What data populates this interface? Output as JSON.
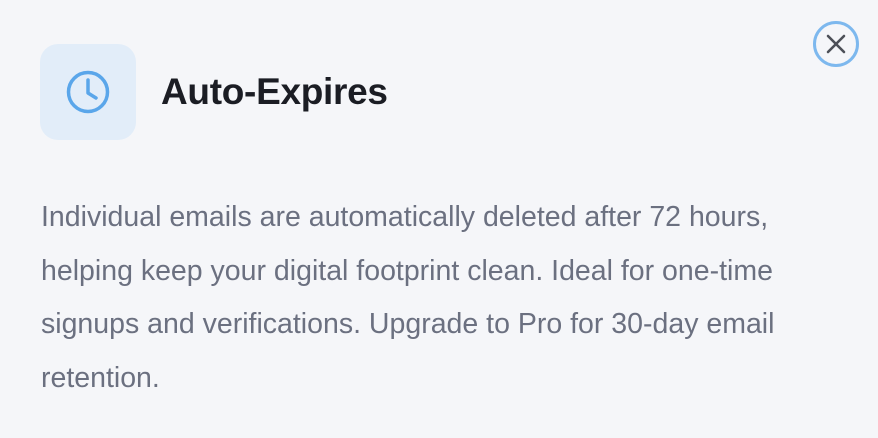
{
  "card": {
    "icon": "clock-icon",
    "title": "Auto-Expires",
    "close": {
      "icon": "close-icon",
      "label": "Close"
    },
    "description": "Individual emails are automatically deleted after 72 hours, helping keep your digital footprint clean. Ideal for one-time signups and verifications. Upgrade to Pro for 30-day email retention."
  },
  "colors": {
    "accent": "#5aa6ea",
    "icon_tile_bg": "#e2edf9",
    "title": "#1b1d24",
    "body_text": "#6b7080",
    "close_ring": "#7db8ee",
    "background": "#f5f6f9"
  }
}
